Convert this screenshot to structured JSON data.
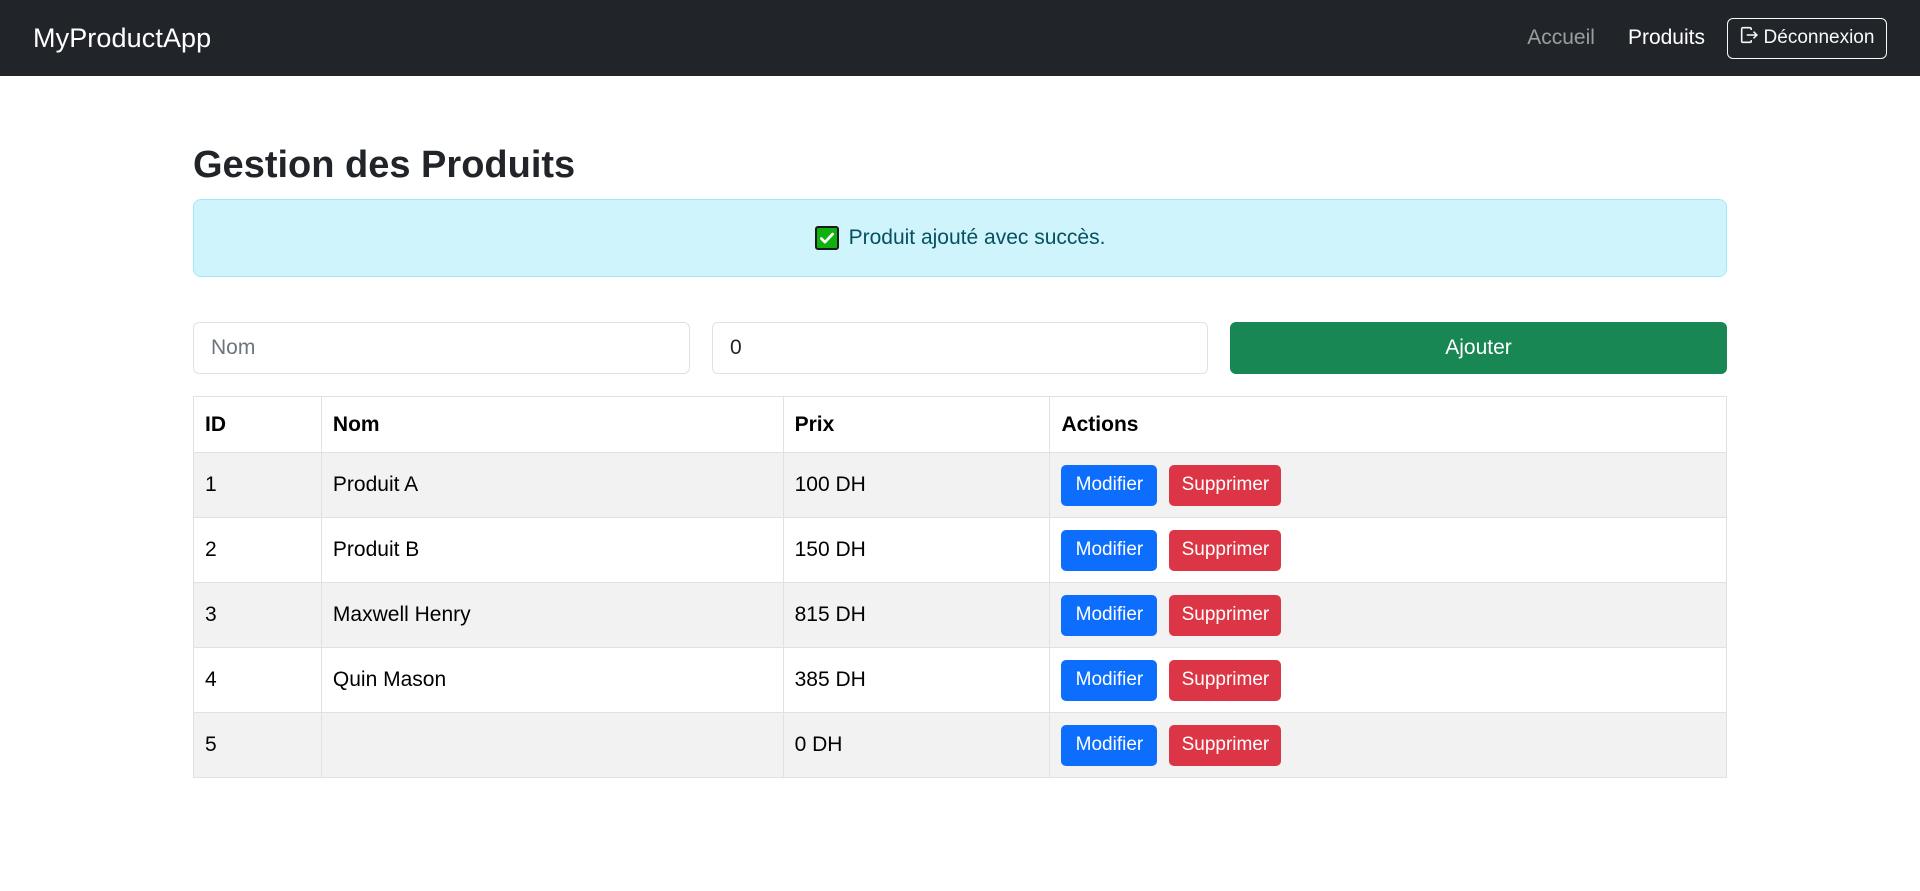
{
  "navbar": {
    "brand": "MyProductApp",
    "links": [
      {
        "label": "Accueil",
        "active": false
      },
      {
        "label": "Produits",
        "active": true
      }
    ],
    "logout_label": "Déconnexion",
    "logout_icon": "logout-icon"
  },
  "page": {
    "title": "Gestion des Produits"
  },
  "alert": {
    "icon": "check-icon",
    "message": "Produit ajouté avec succès."
  },
  "form": {
    "name_placeholder": "Nom",
    "name_value": "",
    "price_value": "0",
    "add_label": "Ajouter"
  },
  "table": {
    "headers": [
      "ID",
      "Nom",
      "Prix",
      "Actions"
    ],
    "rows": [
      {
        "id": "1",
        "name": "Produit A",
        "price": "100 DH"
      },
      {
        "id": "2",
        "name": "Produit B",
        "price": "150 DH"
      },
      {
        "id": "3",
        "name": "Maxwell Henry",
        "price": "815 DH"
      },
      {
        "id": "4",
        "name": "Quin Mason",
        "price": "385 DH"
      },
      {
        "id": "5",
        "name": "",
        "price": "0 DH"
      }
    ],
    "edit_label": "Modifier",
    "delete_label": "Supprimer"
  },
  "colors": {
    "navbar_bg": "#212529",
    "alert_bg": "#cff4fc",
    "add_button": "#198754",
    "edit_button": "#0d6efd",
    "delete_button": "#dc3545"
  }
}
